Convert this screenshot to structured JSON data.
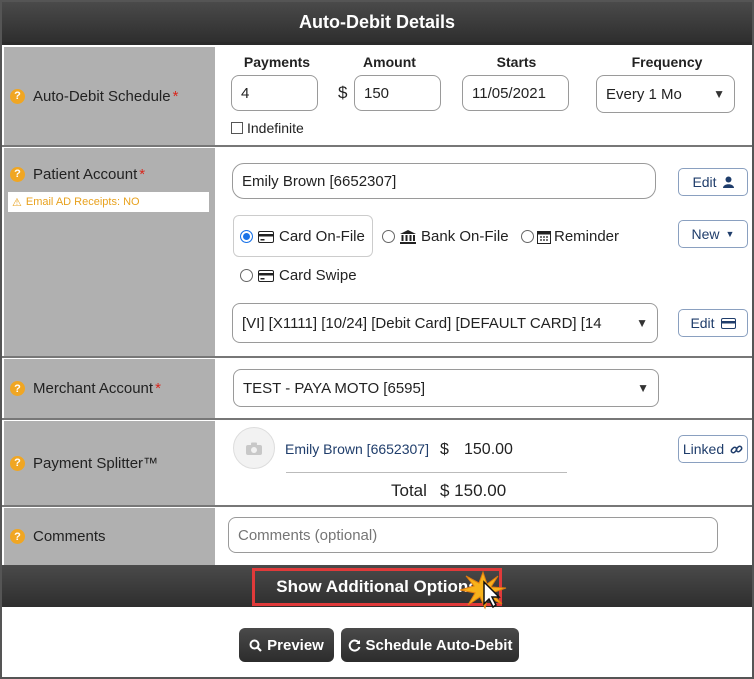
{
  "header": {
    "title": "Auto-Debit Details"
  },
  "schedule": {
    "label": "Auto-Debit Schedule",
    "required_mark": "*",
    "columns": {
      "payments": "Payments",
      "amount": "Amount",
      "starts": "Starts",
      "frequency": "Frequency"
    },
    "payments_value": "4",
    "currency_symbol": "$",
    "amount_value": "150",
    "starts_value": "11/05/2021",
    "frequency_value": "Every 1 Mo",
    "indefinite_label": "Indefinite"
  },
  "patient": {
    "label": "Patient Account",
    "required_mark": "*",
    "warning": "Email AD Receipts: NO",
    "account_value": "Emily Brown [6652307]",
    "edit_label": "Edit",
    "new_label": "New",
    "payment_types": [
      {
        "label": "Card On-File",
        "checked": true,
        "icon": "credit-card-icon"
      },
      {
        "label": "Bank On-File",
        "checked": false,
        "icon": "bank-icon"
      },
      {
        "label": "Reminder",
        "checked": false,
        "icon": "calendar-icon"
      },
      {
        "label": "Card Swipe",
        "checked": false,
        "icon": "credit-card-icon"
      }
    ],
    "card_value": "[VI] [X1111] [10/24] [Debit Card] [DEFAULT CARD] [14",
    "card_edit_label": "Edit"
  },
  "merchant": {
    "label": "Merchant Account",
    "required_mark": "*",
    "value": "TEST - PAYA MOTO [6595]"
  },
  "splitter": {
    "label": "Payment Splitter™",
    "name": "Emily Brown [6652307]",
    "currency_symbol": "$",
    "amount": "150.00",
    "total_label": "Total",
    "total_value": "$ 150.00",
    "linked_label": "Linked"
  },
  "comments": {
    "label": "Comments",
    "placeholder": "Comments (optional)"
  },
  "options_bar": {
    "label": "Show Additional Options"
  },
  "footer": {
    "preview_label": "Preview",
    "schedule_label": "Schedule Auto-Debit"
  },
  "colors": {
    "accent_dark": "#333333",
    "label_bg": "#b0b0b0",
    "warning": "#e8a21f",
    "highlight_border": "#e03a3a",
    "link": "#1f3d6b"
  }
}
